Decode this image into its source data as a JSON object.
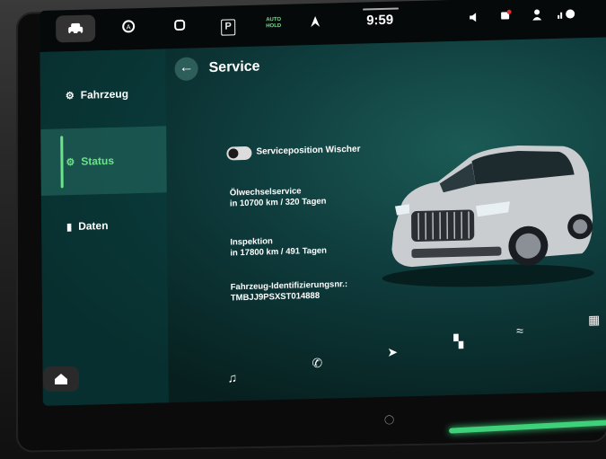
{
  "topbar": {
    "time": "9:59",
    "auto_hold_line1": "AUTO",
    "auto_hold_line2": "HOLD",
    "parking_label": "P",
    "icons": [
      "car-icon",
      "assist-off-icon",
      "seat-icon",
      "parking-icon",
      "auto-hold-icon",
      "navigation-arrow-icon",
      "volume-icon",
      "notification-icon",
      "user-icon",
      "connectivity-icon"
    ]
  },
  "sidebar": {
    "items": [
      {
        "label": "Fahrzeug",
        "icon": "car-settings-icon"
      },
      {
        "label": "Status",
        "icon": "car-status-icon"
      },
      {
        "label": "Daten",
        "icon": "bar-chart-icon"
      }
    ]
  },
  "page": {
    "title": "Service",
    "toggle_label": "Serviceposition Wischer",
    "oil_label": "Ölwechselservice",
    "oil_value": "in 10700 km / 320 Tagen",
    "inspection_label": "Inspektion",
    "inspection_value": "in 17800 km / 491 Tagen",
    "vin_label": "Fahrzeug-Identifizierungsnr.:",
    "vin_value": "TMBJJ9PSXST014888"
  },
  "colors": {
    "accent": "#6de38a",
    "background": "#0e3a3b"
  }
}
